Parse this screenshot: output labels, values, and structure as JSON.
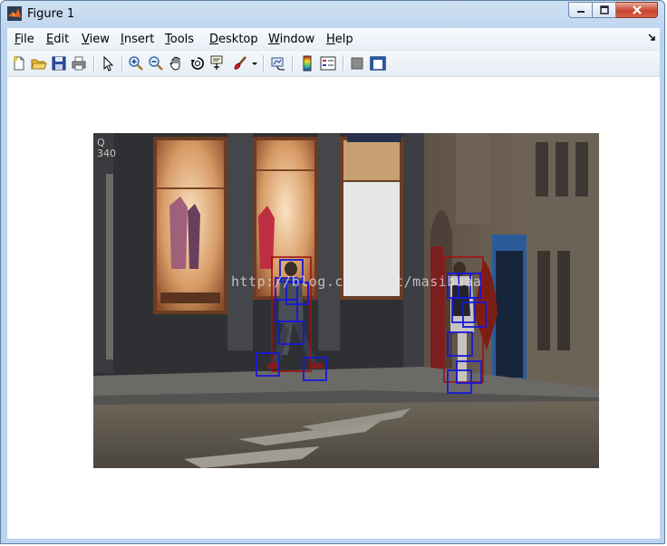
{
  "window": {
    "title": "Figure 1",
    "app_icon": "matlab-icon",
    "controls": [
      "minimize-icon",
      "maximize-icon",
      "close-icon"
    ]
  },
  "menubar": {
    "items": [
      {
        "label": "File",
        "mnemonic": "F",
        "rest": "ile"
      },
      {
        "label": "Edit",
        "mnemonic": "E",
        "rest": "dit"
      },
      {
        "label": "View",
        "mnemonic": "V",
        "rest": "iew"
      },
      {
        "label": "Insert",
        "mnemonic": "I",
        "rest": "nsert"
      },
      {
        "label": "Tools",
        "mnemonic": "T",
        "rest": "ools"
      },
      {
        "label": "Desktop",
        "mnemonic": "D",
        "rest": "esktop"
      },
      {
        "label": "Window",
        "mnemonic": "W",
        "rest": "indow"
      },
      {
        "label": "Help",
        "mnemonic": "H",
        "rest": "elp"
      }
    ],
    "dock_icon": "dock-arrow-icon"
  },
  "toolbar": {
    "buttons": [
      "new-figure-icon",
      "open-file-icon",
      "save-figure-icon",
      "print-figure-icon",
      "edit-plot-arrow-icon",
      "zoom-in-icon",
      "zoom-out-icon",
      "pan-hand-icon",
      "rotate-3d-icon",
      "data-cursor-icon",
      "brush-icon",
      "brush-dropdown-icon",
      "link-plot-icon",
      "insert-colorbar-icon",
      "insert-legend-icon",
      "hide-plot-tools-icon",
      "show-plot-tools-icon"
    ]
  },
  "figure": {
    "image": "street-scene-pedestrian-detection",
    "watermark": "http://blog.csdn.net/masibuaa",
    "detection_colors": {
      "person_box": "#a01010",
      "part_box": "#1818d8"
    }
  }
}
